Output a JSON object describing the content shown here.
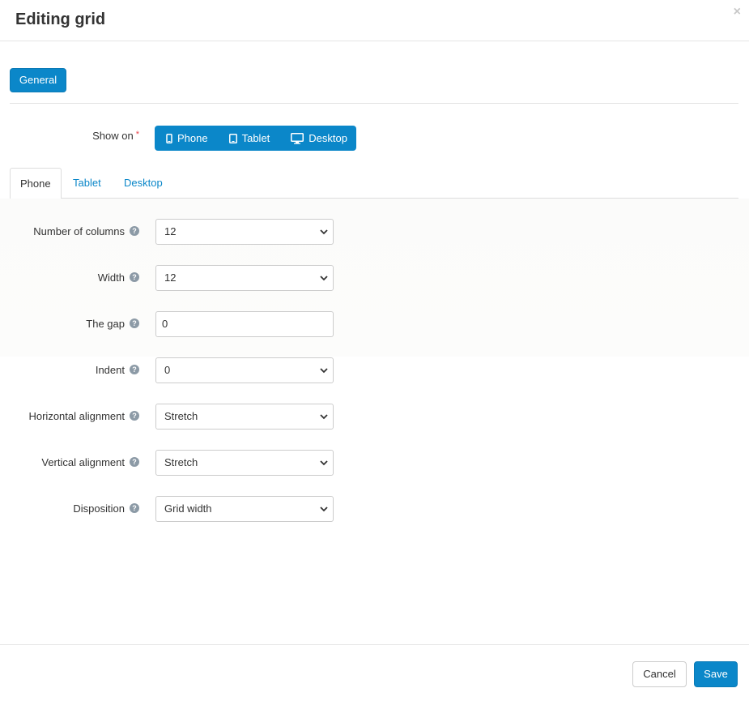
{
  "dialog": {
    "title": "Editing grid",
    "close_glyph": "×"
  },
  "section_button": "General",
  "show_on": {
    "label": "Show on",
    "required_mark": "*",
    "options": [
      {
        "label": "Phone",
        "icon": "phone-icon"
      },
      {
        "label": "Tablet",
        "icon": "tablet-icon"
      },
      {
        "label": "Desktop",
        "icon": "desktop-icon"
      }
    ]
  },
  "tabs": [
    "Phone",
    "Tablet",
    "Desktop"
  ],
  "active_tab": "Phone",
  "fields": {
    "num_columns": {
      "label": "Number of columns",
      "value": "12"
    },
    "width": {
      "label": "Width",
      "value": "12"
    },
    "gap": {
      "label": "The gap",
      "value": "0"
    },
    "indent": {
      "label": "Indent",
      "value": "0"
    },
    "h_align": {
      "label": "Horizontal alignment",
      "value": "Stretch"
    },
    "v_align": {
      "label": "Vertical alignment",
      "value": "Stretch"
    },
    "disposition": {
      "label": "Disposition",
      "value": "Grid width"
    }
  },
  "help_glyph": "?",
  "footer": {
    "cancel": "Cancel",
    "save": "Save"
  },
  "colors": {
    "accent": "#0b87c9",
    "required": "#e8464e"
  }
}
